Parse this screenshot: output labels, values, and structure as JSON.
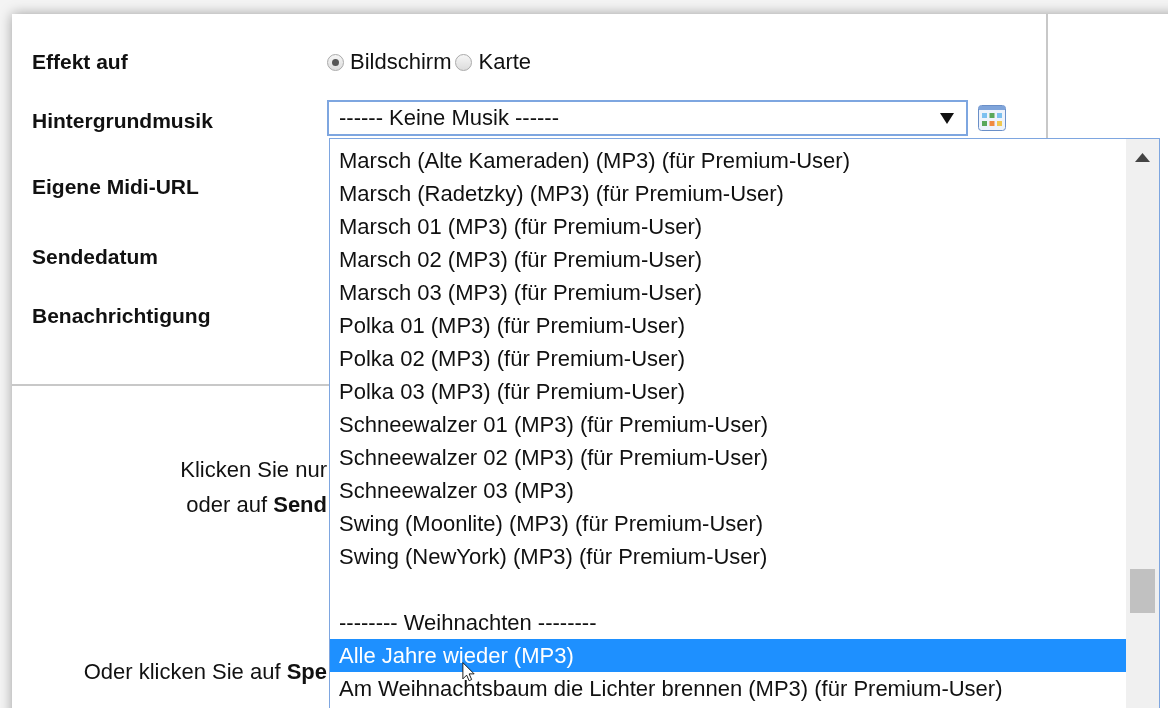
{
  "form": {
    "rows": [
      {
        "label": "Effekt auf",
        "kind": "radios",
        "options": [
          {
            "label": "Bildschirm",
            "selected": true
          },
          {
            "label": "Karte",
            "selected": false
          }
        ]
      },
      {
        "label": "Hintergrundmusik",
        "kind": "select",
        "value": "------ Keine Musik ------"
      },
      {
        "label": "Eigene Midi-URL",
        "kind": "hidden"
      },
      {
        "label": "Sendedatum",
        "kind": "hidden"
      },
      {
        "label": "Benachrichtigung",
        "kind": "hidden"
      }
    ]
  },
  "instructions": {
    "lines": [
      "Klicken Sie nur",
      "oder auf **Send**"
    ],
    "footer": "Oder klicken Sie auf **Spe**"
  },
  "dropdown_list": {
    "items": [
      {
        "kind": "option",
        "label": "Marsch (Alte Kameraden) (MP3) (für Premium-User)",
        "selected": false
      },
      {
        "kind": "option",
        "label": "Marsch (Radetzky) (MP3) (für Premium-User)",
        "selected": false
      },
      {
        "kind": "option",
        "label": "Marsch 01 (MP3) (für Premium-User)",
        "selected": false
      },
      {
        "kind": "option",
        "label": "Marsch 02 (MP3) (für Premium-User)",
        "selected": false
      },
      {
        "kind": "option",
        "label": "Marsch 03 (MP3) (für Premium-User)",
        "selected": false
      },
      {
        "kind": "option",
        "label": "Polka 01 (MP3) (für Premium-User)",
        "selected": false
      },
      {
        "kind": "option",
        "label": "Polka 02 (MP3) (für Premium-User)",
        "selected": false
      },
      {
        "kind": "option",
        "label": "Polka 03 (MP3) (für Premium-User)",
        "selected": false
      },
      {
        "kind": "option",
        "label": "Schneewalzer 01 (MP3) (für Premium-User)",
        "selected": false
      },
      {
        "kind": "option",
        "label": "Schneewalzer 02 (MP3) (für Premium-User)",
        "selected": false
      },
      {
        "kind": "option",
        "label": "Schneewalzer 03 (MP3)",
        "selected": false
      },
      {
        "kind": "option",
        "label": "Swing (Moonlite) (MP3) (für Premium-User)",
        "selected": false
      },
      {
        "kind": "option",
        "label": "Swing (NewYork) (MP3) (für Premium-User)",
        "selected": false
      },
      {
        "kind": "blank"
      },
      {
        "kind": "group",
        "label": "-------- Weihnachten --------"
      },
      {
        "kind": "option",
        "label": "Alle Jahre wieder (MP3)",
        "selected": true
      },
      {
        "kind": "option",
        "label": "Am Weihnachtsbaum die Lichter brennen (MP3) (für Premium-User)",
        "selected": false
      }
    ]
  }
}
